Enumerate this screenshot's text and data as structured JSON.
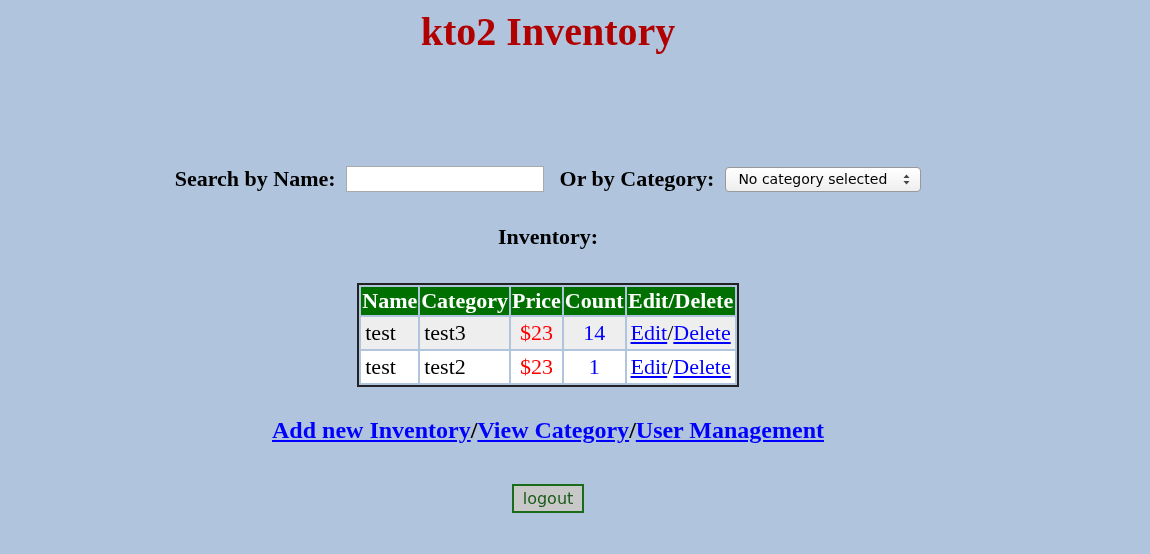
{
  "title": "kto2 Inventory",
  "search": {
    "name_label": "Search by Name:",
    "category_label": "Or by Category:",
    "category_value": "No category selected"
  },
  "inventory_heading": "Inventory:",
  "table": {
    "columns": [
      "Name",
      "Category",
      "Price",
      "Count",
      "Edit/Delete"
    ],
    "rows": [
      {
        "name": "test",
        "category": "test3",
        "price": "$23",
        "count": "14",
        "actions": [
          {
            "kind": "link",
            "text": "Edit"
          },
          {
            "kind": "sep",
            "text": "/"
          },
          {
            "kind": "link",
            "text": "Delete"
          }
        ]
      },
      {
        "name": "test",
        "category": "test2",
        "price": "$23",
        "count": "1",
        "actions": [
          {
            "kind": "link",
            "text": "Edit"
          },
          {
            "kind": "sep",
            "text": "/"
          },
          {
            "kind": "link",
            "text": "Delete"
          }
        ]
      }
    ]
  },
  "links": [
    {
      "kind": "link",
      "text": "Add new Inventory"
    },
    {
      "kind": "sep",
      "text": "/"
    },
    {
      "kind": "link",
      "text": "View Category"
    },
    {
      "kind": "sep",
      "text": "/"
    },
    {
      "kind": "link",
      "text": "User Management"
    }
  ],
  "logout": "logout"
}
